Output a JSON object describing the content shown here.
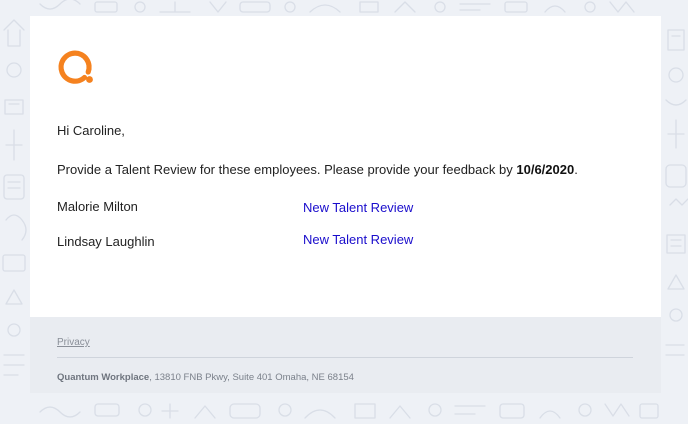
{
  "email": {
    "greeting": "Hi Caroline,",
    "instruction_text": "Provide a Talent Review for these employees. Please provide your feedback by",
    "due_date": "10/6/2020",
    "instruction_suffix": ".",
    "employees": [
      {
        "name": "Malorie Milton",
        "link_label": "New Talent Review"
      },
      {
        "name": "Lindsay Laughlin",
        "link_label": "New Talent Review"
      }
    ]
  },
  "footer": {
    "privacy_label": "Privacy",
    "company_name": "Quantum Workplace",
    "address": ", 13810 FNB Pkwy, Suite 401 Omaha, NE 68154"
  },
  "colors": {
    "accent_orange": "#f5821f",
    "link_blue": "#1a0dcc",
    "background": "#eef1f6",
    "footer_bg": "#e9ecf1"
  },
  "icons": {
    "logo": "quantum-workplace-logo-icon",
    "background": "doodle-pattern"
  }
}
